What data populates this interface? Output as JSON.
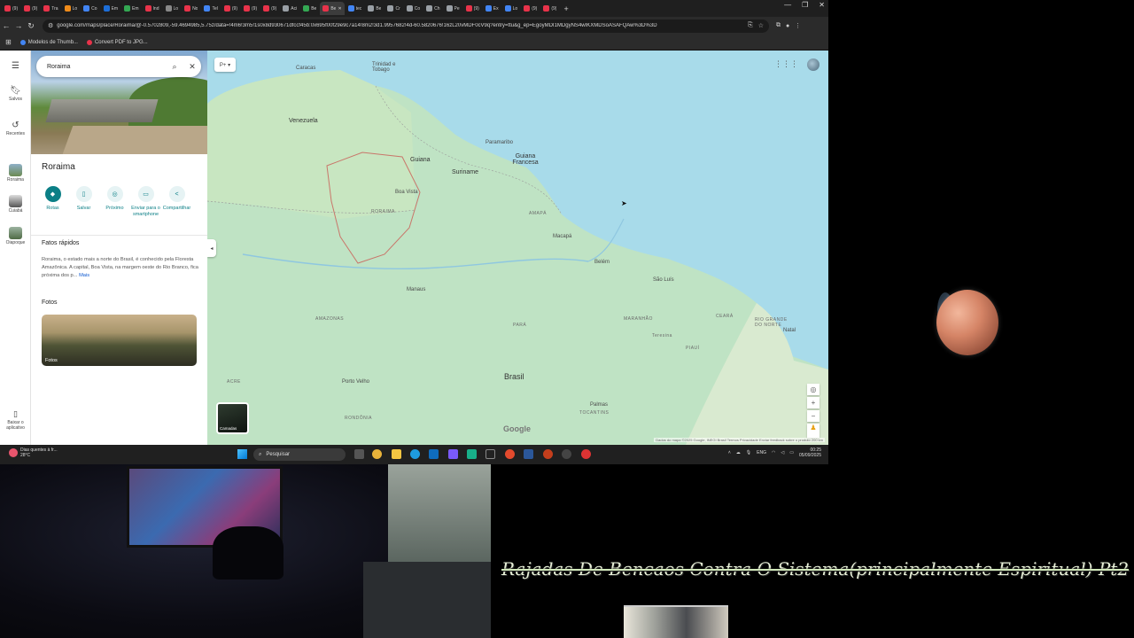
{
  "browser": {
    "tabs": [
      {
        "label": "(9)",
        "color": "#e8334a"
      },
      {
        "label": "(9)",
        "color": "#e8334a"
      },
      {
        "label": "Tra",
        "color": "#e8334a"
      },
      {
        "label": "Lo",
        "color": "#f08c1a"
      },
      {
        "label": "Co",
        "color": "#4285f4"
      },
      {
        "label": "Em",
        "color": "#1d6ed8"
      },
      {
        "label": "Em",
        "color": "#34a853"
      },
      {
        "label": "Ind",
        "color": "#e8334a"
      },
      {
        "label": "Lo",
        "color": "#888888"
      },
      {
        "label": "No",
        "color": "#e8334a"
      },
      {
        "label": "Tel",
        "color": "#4285f4"
      },
      {
        "label": "(9)",
        "color": "#e8334a"
      },
      {
        "label": "(9)",
        "color": "#e8334a"
      },
      {
        "label": "(9)",
        "color": "#e8334a"
      },
      {
        "label": "Aci",
        "color": "#9aa0a6"
      },
      {
        "label": "Be",
        "color": "#34a853"
      },
      {
        "label": "Be",
        "color": "#e8334a",
        "active": true
      },
      {
        "label": "tec",
        "color": "#4285f4"
      },
      {
        "label": "Be",
        "color": "#9aa0a6"
      },
      {
        "label": "Cr",
        "color": "#9aa0a6"
      },
      {
        "label": "Co",
        "color": "#9aa0a6"
      },
      {
        "label": "Ch",
        "color": "#9aa0a6"
      },
      {
        "label": "Pe",
        "color": "#9aa0a6"
      },
      {
        "label": "(9)",
        "color": "#e8334a"
      },
      {
        "label": "Ex",
        "color": "#4285f4"
      },
      {
        "label": "Lo",
        "color": "#4285f4"
      },
      {
        "label": "(9)",
        "color": "#e8334a"
      },
      {
        "label": "(9)",
        "color": "#e8334a"
      }
    ],
    "url": "google.com/maps/place/Roraima/@-0.5702809,-59.4694985,5.75z/data=!4m6!3m5!1s0x8d930671dfccf45b:0x695f00f29e9c7a14!8m2!3d1.9957682!4d-60.5820676!16zL20vMDF0cV9q?entry=ttu&g_ep=EgoyMDI1MDgyNS4wIKXMDSoASAFQAw%3D%3D",
    "bookmarks": [
      {
        "label": "Modelos de Thumb...",
        "color": "#4285f4"
      },
      {
        "label": "Convert PDF to JPG...",
        "color": "#e8334a"
      }
    ]
  },
  "rail": {
    "saved": "Salvos",
    "recent": "Recentes",
    "roraima": "Roraima",
    "cuiaba": "Cuiabá",
    "oiapoque": "Oiapoque",
    "download": "Baixar o aplicativo"
  },
  "panel": {
    "search_value": "Roraima",
    "title": "Roraima",
    "actions": [
      {
        "label": "Rotas",
        "icon": "directions-icon"
      },
      {
        "label": "Salvar",
        "icon": "bookmark-icon"
      },
      {
        "label": "Próximo",
        "icon": "nearby-icon"
      },
      {
        "label": "Enviar para o smartphone",
        "icon": "phone-icon"
      },
      {
        "label": "Compartilhar",
        "icon": "share-icon"
      }
    ],
    "facts_heading": "Fatos rápidos",
    "facts_text": "Roraima, o estado mais a norte do Brasil, é conhecido pela Floresta Amazônica. A capital, Boa Vista, na margem oeste do Rio Branco, fica próxima dos p...",
    "facts_more": "Mais",
    "photos_heading": "Fotos",
    "photo_label": "Fotos"
  },
  "map": {
    "labels": {
      "caracas": "Caracas",
      "trinidad": "Trinidad e Tobago",
      "venezuela": "Venezuela",
      "paramaribo": "Paramaribo",
      "guiana": "Guiana",
      "suriname": "Suriname",
      "guiana_francesa": "Guiana Francesa",
      "boa_vista": "Boa Vista",
      "roraima": "RORAIMA",
      "amapa": "AMAPÁ",
      "macapa": "Macapá",
      "belem": "Belém",
      "manaus": "Manaus",
      "sao_luis": "São Luís",
      "amazonas": "AMAZONAS",
      "para": "PARÁ",
      "maranhao": "MARANHÃO",
      "ceara": "CEARÁ",
      "rio_grande": "RIO GRANDE DO NORTE",
      "natal": "Natal",
      "piaui": "PIAUÍ",
      "brasil": "Brasil",
      "acre": "ACRE",
      "porto_velho": "Porto Velho",
      "rondonia": "RONDÔNIA",
      "tocantins": "TOCANTINS",
      "palmas": "Palmas",
      "teresina": "Teresina"
    },
    "layers_label": "Camadas",
    "google": "Google",
    "attribution": "Dados do mapa ©2025 Google, INEGI   Brasil   Termos   Privacidade   Enviar feedback sobre o produto   200 km"
  },
  "taskbar": {
    "weather_line1": "Dias quentes à fr...",
    "weather_line2": "28°C",
    "search_placeholder": "Pesquisar",
    "lang": "ENG",
    "time": "00:25",
    "date": "05/09/2025"
  },
  "stream": {
    "overlay_text": "Rajadas De Bencaos Contra O Sistema(principalmente Espiritual) Pt2"
  }
}
